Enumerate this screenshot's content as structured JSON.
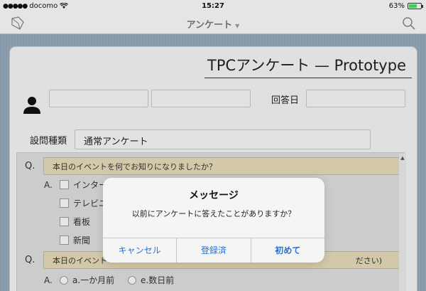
{
  "statusbar": {
    "carrier": "docomo",
    "time": "15:27",
    "battery_text": "63%",
    "battery_level": 0.63
  },
  "navbar": {
    "title": "アンケート",
    "left_icon": "flag-icon",
    "right_icon": "search-icon"
  },
  "card": {
    "title": "TPCアンケート — Prototype",
    "answer_date_label": "回答日",
    "question_type_label": "設問種類",
    "question_type_value": "通常アンケート"
  },
  "questions": [
    {
      "label": "Q.",
      "text": "本日のイベントを何でお知りになりましたか？",
      "answer_label": "A.",
      "options": [
        "インター",
        "テレビニ",
        "看板",
        "新聞"
      ]
    },
    {
      "label": "Q.",
      "text": "本日のイベント",
      "text_tail": "ださい)",
      "answer_label": "A.",
      "options": [
        "a.一か月前",
        "e.数日前"
      ]
    }
  ],
  "alert": {
    "title": "メッセージ",
    "message": "以前にアンケートに答えたことがありますか？",
    "buttons": [
      "キャンセル",
      "登録済",
      "初めて"
    ]
  },
  "colors": {
    "accent": "#2a6fd6",
    "question_bg": "#e3d8b6",
    "background": "#8fa4b4"
  }
}
